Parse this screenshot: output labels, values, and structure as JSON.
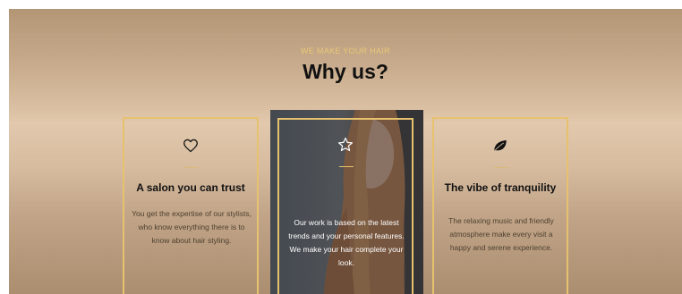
{
  "section": {
    "eyebrow": "WE MAKE YOUR HAIR",
    "heading": "Why us?"
  },
  "cards": [
    {
      "icon": "heart-icon",
      "title": "A salon you can trust",
      "text": "You get the expertise of our stylists, who know everything there is to know about hair styling."
    },
    {
      "icon": "star-icon",
      "title": "",
      "text": "Our work is based on the latest trends and your personal features. We make your hair complete your look."
    },
    {
      "icon": "leaf-icon",
      "title": "The vibe of tranquility",
      "text": "The relaxing music and friendly atmosphere make every visit a happy and serene experience."
    }
  ],
  "colors": {
    "accent": "#e7c26e",
    "heading": "#111111",
    "body_text": "#4d4030"
  }
}
